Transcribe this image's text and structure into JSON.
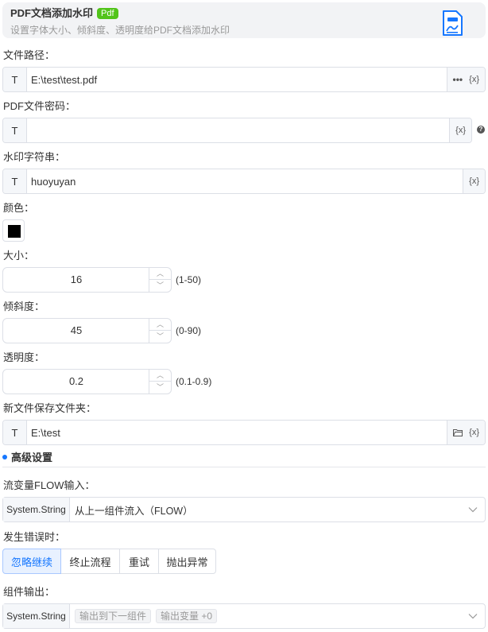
{
  "header": {
    "title": "PDF文档添加水印",
    "badge": "Pdf",
    "subtitle": "设置字体大小、倾斜度、透明度给PDF文档添加水印",
    "icon": "pdf-file-icon"
  },
  "fields": {
    "file_path": {
      "label": "文件路径：",
      "prefix": "T",
      "value": "E:\\test\\test.pdf",
      "more": "•••",
      "var": "{x}"
    },
    "password": {
      "label": "PDF文件密码：",
      "prefix": "T",
      "value": "",
      "var": "{x}",
      "help": "?"
    },
    "watermark": {
      "label": "水印字符串：",
      "prefix": "T",
      "value": "huoyuyan",
      "var": "{x}"
    },
    "color": {
      "label": "颜色：",
      "value": "#000000"
    },
    "size": {
      "label": "大小：",
      "value": "16",
      "range": "(1-50)"
    },
    "tilt": {
      "label": "倾斜度：",
      "value": "45",
      "range": "(0-90)"
    },
    "opacity": {
      "label": "透明度：",
      "value": "0.2",
      "range": "(0.1-0.9)"
    },
    "save_folder": {
      "label": "新文件保存文件夹：",
      "prefix": "T",
      "value": "E:\\test",
      "var": "{x}"
    }
  },
  "advanced": {
    "title": "高级设置",
    "flow_input": {
      "label": "流变量FLOW输入：",
      "prefix": "System.String",
      "value": "从上一组件流入（FLOW）"
    },
    "on_error": {
      "label": "发生错误时：",
      "options": [
        "忽略继续",
        "终止流程",
        "重试",
        "抛出异常"
      ],
      "selected": "忽略继续"
    },
    "output": {
      "label": "组件输出：",
      "prefix": "System.String",
      "tags": [
        "输出到下一组件",
        "输出变量 +0"
      ]
    }
  },
  "colors": {
    "accent": "#1677ff",
    "badge": "#52c41a"
  }
}
